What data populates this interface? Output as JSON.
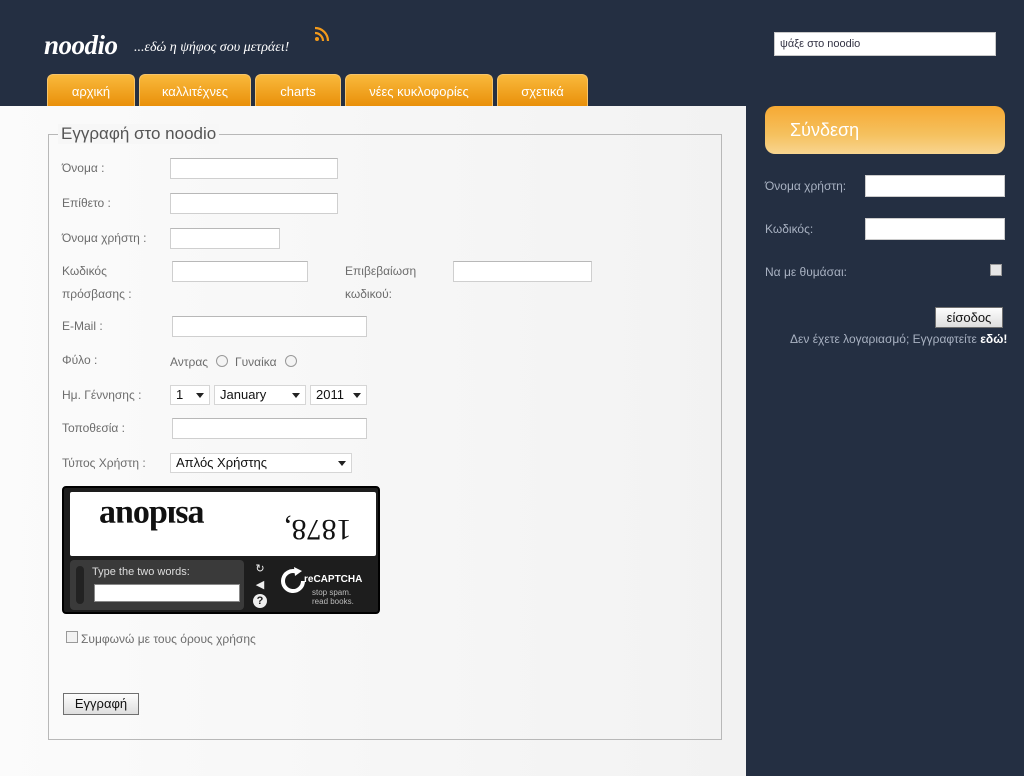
{
  "header": {
    "logo": "noodio",
    "tagline": "...εδώ η ψήφος σου μετράει!",
    "search_placeholder": "ψάξε στο noodio"
  },
  "nav": {
    "tabs": [
      {
        "label": "αρχική"
      },
      {
        "label": "καλλιτέχνες"
      },
      {
        "label": "charts"
      },
      {
        "label": "νέες κυκλοφορίες"
      },
      {
        "label": "σχετικά"
      }
    ]
  },
  "register": {
    "title": "Εγγραφή στο noodio",
    "first_name_label": "Όνομα :",
    "last_name_label": "Επίθετο :",
    "username_label": "Όνομα χρήστη :",
    "password_label_1": "Κωδικός",
    "password_label_2": "πρόσβασης :",
    "confirm_label_1": "Επιβεβαίωση",
    "confirm_label_2": "κωδικού:",
    "email_label": "E-Mail :",
    "gender_label": "Φύλο :",
    "gender_male": "Αντρας",
    "gender_female": "Γυναίκα",
    "birthdate_label": "Ημ. Γέννησης :",
    "birth_day": "1",
    "birth_month": "January",
    "birth_year": "2011",
    "location_label": "Τοποθεσία :",
    "user_type_label": "Τύπος Χρήστη :",
    "user_type_value": "Απλός Χρήστης",
    "captcha_word": "ɐsıdouɐ",
    "captcha_number": "1878,",
    "captcha_prompt": "Type the two words:",
    "captcha_brand": "reCAPTCHA",
    "captcha_tagline_1": "stop spam.",
    "captcha_tagline_2": "read books.",
    "terms_label": "Συμφωνώ με τους όρους χρήσης",
    "submit_label": "Εγγραφή"
  },
  "login": {
    "title": "Σύνδεση",
    "username_label": "Όνομα χρήστη:",
    "password_label": "Κωδικός:",
    "remember_label": "Να με θυμάσαι:",
    "submit_label": "είσοδος",
    "no_account_text": "Δεν έχετε λογαριασμό; Εγγραφτείτε",
    "register_link": "εδώ!"
  },
  "colors": {
    "background": "#242f42",
    "accent": "#f5a623"
  }
}
